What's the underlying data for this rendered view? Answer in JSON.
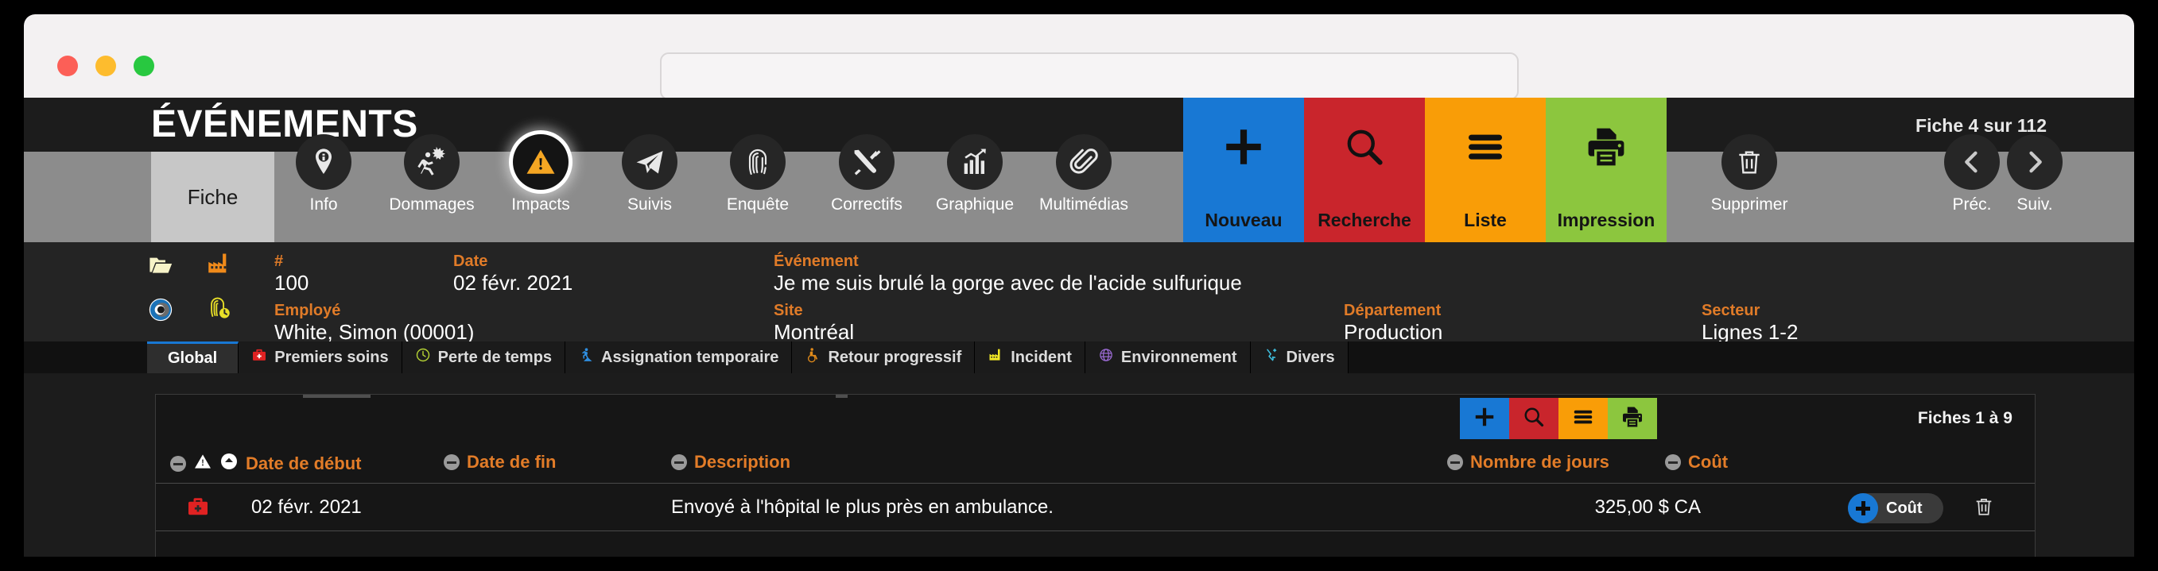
{
  "window": {
    "traffic_lights": [
      "close",
      "minimize",
      "zoom"
    ],
    "url_value": "",
    "url_placeholder": ""
  },
  "header": {
    "title": "ÉVÉNEMENTS",
    "counter_prefix": "Fiche",
    "counter_current": "4",
    "counter_middle": "sur",
    "counter_total": "112",
    "counter_full": "Fiche 4 sur 112"
  },
  "nav": {
    "fiche_tab": "Fiche",
    "items": [
      {
        "label": "Info",
        "icon": "info-pin-icon",
        "active": false
      },
      {
        "label": "Dommages",
        "icon": "injury-icon",
        "active": false
      },
      {
        "label": "Impacts",
        "icon": "warning-icon",
        "active": true
      },
      {
        "label": "Suivis",
        "icon": "paper-plane-icon",
        "active": false
      },
      {
        "label": "Enquête",
        "icon": "fingerprint-icon",
        "active": false
      },
      {
        "label": "Correctifs",
        "icon": "tools-icon",
        "active": false
      },
      {
        "label": "Graphique",
        "icon": "bar-chart-icon",
        "active": false
      },
      {
        "label": "Multimédias",
        "icon": "paperclip-icon",
        "active": false
      }
    ],
    "actions": [
      {
        "label": "Nouveau",
        "icon": "plus-icon",
        "color": "#1878d4"
      },
      {
        "label": "Recherche",
        "icon": "magnifier-icon",
        "color": "#c9252c"
      },
      {
        "label": "Liste",
        "icon": "list-icon",
        "color": "#f99d07"
      },
      {
        "label": "Impression",
        "icon": "printer-icon",
        "color": "#8cc63e"
      }
    ],
    "delete": {
      "label": "Supprimer",
      "icon": "trash-icon"
    },
    "prev": {
      "label": "Préc.",
      "icon": "chevron-left-icon"
    },
    "next": {
      "label": "Suiv.",
      "icon": "chevron-right-icon"
    }
  },
  "detail": {
    "row_icons": [
      "open-folder-icon",
      "factory-icon",
      "target-ring-icon",
      "fingerprint-clock-icon"
    ],
    "fields": [
      {
        "label": "#",
        "value": "100"
      },
      {
        "label": "Date",
        "value": "02 févr. 2021"
      },
      {
        "label": "Événement",
        "value": "Je me suis brulé la gorge avec de l'acide sulfurique"
      },
      {
        "label": "Employé",
        "value": "White, Simon (00001)"
      },
      {
        "label": "Site",
        "value": "Montréal"
      },
      {
        "label": "Département",
        "value": "Production"
      },
      {
        "label": "Secteur",
        "value": "Lignes 1-2"
      }
    ]
  },
  "section_tabs": [
    {
      "label": "Global",
      "icon": null,
      "active": true
    },
    {
      "label": "Premiers soins",
      "icon": "first-aid-kit-icon",
      "active": false
    },
    {
      "label": "Perte de temps",
      "icon": "clock-icon",
      "active": false
    },
    {
      "label": "Assignation temporaire",
      "icon": "worker-icon",
      "active": false
    },
    {
      "label": "Retour progressif",
      "icon": "wheelchair-icon",
      "active": false
    },
    {
      "label": "Incident",
      "icon": "factory-yellow-icon",
      "active": false
    },
    {
      "label": "Environnement",
      "icon": "globe-icon",
      "active": false
    },
    {
      "label": "Divers",
      "icon": "misc-arrow-icon",
      "active": false
    }
  ],
  "subpanel": {
    "toolbar": [
      {
        "label": "Nouveau",
        "icon": "plus-icon",
        "color": "#1878d4"
      },
      {
        "label": "Recherche",
        "icon": "magnifier-icon",
        "color": "#c9252c"
      },
      {
        "label": "Liste",
        "icon": "list-icon",
        "color": "#f99d07"
      },
      {
        "label": "Impression",
        "icon": "printer-icon",
        "color": "#8cc63e"
      }
    ],
    "count_label": "Fiches 1 à 9",
    "columns": [
      {
        "label": "Date de début",
        "sorted": true
      },
      {
        "label": "Date de fin",
        "sorted": false
      },
      {
        "label": "Description",
        "sorted": false
      },
      {
        "label": "Nombre de jours",
        "sorted": false
      },
      {
        "label": "Coût",
        "sorted": false
      }
    ],
    "rows": [
      {
        "icon": "first-aid-kit-icon",
        "date_debut": "02 févr. 2021",
        "date_fin": "",
        "description": "Envoyé à l'hôpital le plus près en ambulance.",
        "nombre_de_jours": "",
        "cout": "325,00 $ CA",
        "action_label": "Coût",
        "delete_icon": "trash-icon"
      }
    ]
  },
  "colors": {
    "accent_orange": "#e07b28",
    "blue": "#1878d4",
    "red": "#c9252c",
    "amber": "#f99d07",
    "green": "#8cc63e",
    "bg_dark": "#1c1c1c",
    "bg_panel": "#242424",
    "nav_grey": "#8c8c8c"
  }
}
